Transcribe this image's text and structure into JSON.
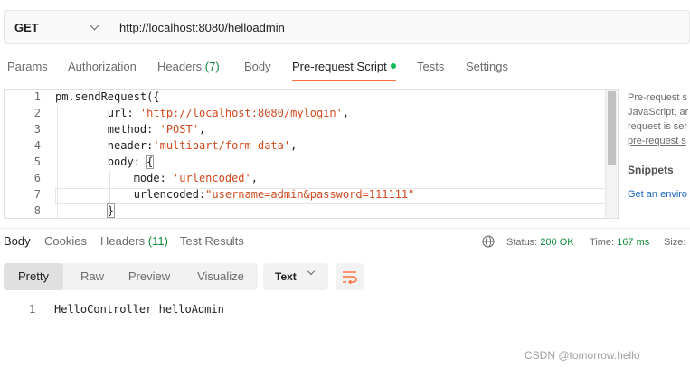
{
  "request": {
    "method": "GET",
    "url": "http://localhost:8080/helloadmin"
  },
  "request_tabs": [
    {
      "label": "Params"
    },
    {
      "label": "Authorization"
    },
    {
      "label": "Headers",
      "count": "(7)"
    },
    {
      "label": "Body"
    },
    {
      "label": "Pre-request Script",
      "active": true
    },
    {
      "label": "Tests"
    },
    {
      "label": "Settings"
    }
  ],
  "editor": {
    "line_numbers": [
      "1",
      "2",
      "3",
      "4",
      "5",
      "6",
      "7",
      "8"
    ],
    "lines": [
      {
        "plain": "pm.sendRequest({"
      },
      {
        "plain": "        url: ",
        "str": "'http://localhost:8080/mylogin'",
        "tail": ","
      },
      {
        "plain": "        method: ",
        "str": "'POST'",
        "tail": ","
      },
      {
        "plain": "        header:",
        "str": "'multipart/form-data'",
        "tail": ","
      },
      {
        "plain": "        body: ",
        "bracket": "{"
      },
      {
        "plain": "            mode: ",
        "str": "'urlencoded'",
        "tail": ","
      },
      {
        "plain": "            urlencoded:",
        "str": "\"username=admin&password=111111\""
      },
      {
        "plain": "        ",
        "bracket": "}"
      }
    ]
  },
  "side_panel": {
    "desc_lines": [
      "Pre-request s",
      "JavaScript, ar",
      "request is ser"
    ],
    "link": "pre-request s",
    "snippets_title": "Snippets",
    "snippet_first": "Get an enviro"
  },
  "response_tabs": [
    {
      "label": "Body",
      "active": true
    },
    {
      "label": "Cookies"
    },
    {
      "label": "Headers",
      "count": "(11)"
    },
    {
      "label": "Test Results"
    }
  ],
  "status": {
    "status_label": "Status:",
    "status_value": "200 OK",
    "time_label": "Time:",
    "time_value": "167 ms",
    "size_label": "Size:"
  },
  "view_modes": [
    "Pretty",
    "Raw",
    "Preview",
    "Visualize"
  ],
  "format_select": "Text",
  "response_body": {
    "line_number": "1",
    "text": "HelloController helloAdmin"
  },
  "watermark": "CSDN @tomorrow.hello",
  "colors": {
    "accent": "#ff6c37",
    "success": "#0e8a3a",
    "string": "#d14a1e"
  }
}
